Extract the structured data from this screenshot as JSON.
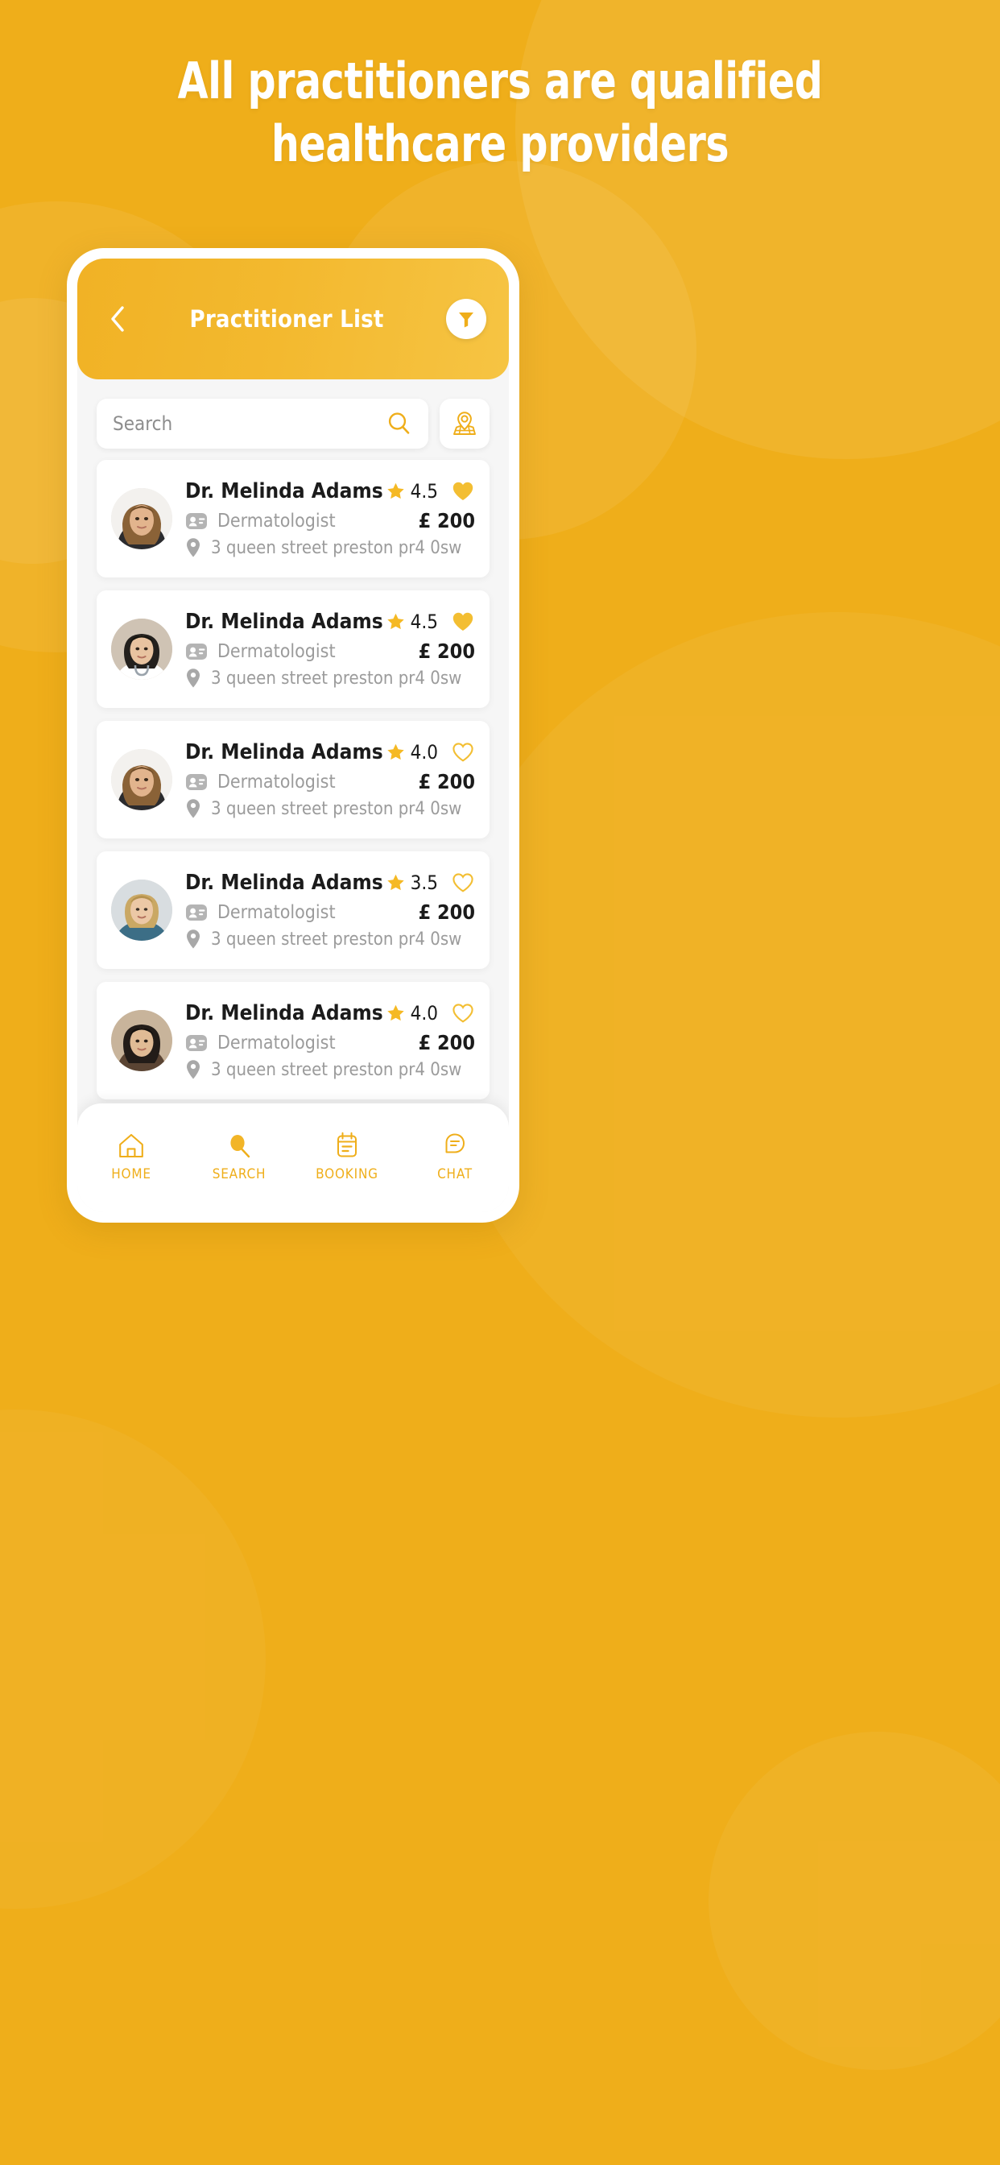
{
  "theme": {
    "brand_yellow": "#EFAE1A",
    "header_yellow": "#F3B92F",
    "star_yellow": "#F5B924",
    "heart_yellow": "#F3BE32",
    "text_dark": "#1B1B1B",
    "text_muted": "#9B9B9B",
    "screen_bg": "#F6F6F6",
    "card_bg": "#FFFFFF"
  },
  "headline": {
    "line1": "All practitioners are qualified",
    "line2": "healthcare providers"
  },
  "app_header": {
    "title": "Practitioner List",
    "back_icon": "chevron-left-icon",
    "filter_icon": "filter-funnel-icon"
  },
  "search": {
    "placeholder": "Search",
    "value": "",
    "search_icon": "search-icon",
    "map_icon": "map-pin-icon"
  },
  "practitioners": [
    {
      "name": "Dr. Melinda Adams",
      "rating": "4.5",
      "favorited": true,
      "specialty": "Dermatologist",
      "price": "£ 200",
      "address": "3 queen street preston pr4 0sw",
      "avatar": "woman-long-brown-hair-black-top",
      "badge_icon": "id-badge-icon",
      "pin_icon": "location-pin-icon",
      "star_icon": "star-icon",
      "heart_icon": "heart-filled-icon"
    },
    {
      "name": "Dr. Melinda Adams",
      "rating": "4.5",
      "favorited": true,
      "specialty": "Dermatologist",
      "price": "£ 200",
      "address": "3 queen street preston pr4 0sw",
      "avatar": "woman-doctor-white-coat-stethoscope",
      "badge_icon": "id-badge-icon",
      "pin_icon": "location-pin-icon",
      "star_icon": "star-icon",
      "heart_icon": "heart-filled-icon"
    },
    {
      "name": "Dr. Melinda Adams",
      "rating": "4.0",
      "favorited": false,
      "specialty": "Dermatologist",
      "price": "£ 200",
      "address": "3 queen street preston pr4 0sw",
      "avatar": "woman-long-brown-hair-black-top",
      "badge_icon": "id-badge-icon",
      "pin_icon": "location-pin-icon",
      "star_icon": "star-icon",
      "heart_icon": "heart-outline-icon"
    },
    {
      "name": "Dr. Melinda Adams",
      "rating": "3.5",
      "favorited": false,
      "specialty": "Dermatologist",
      "price": "£ 200",
      "address": "3 queen street preston pr4 0sw",
      "avatar": "woman-blonde-blue-scrubs",
      "badge_icon": "id-badge-icon",
      "pin_icon": "location-pin-icon",
      "star_icon": "star-icon",
      "heart_icon": "heart-outline-icon"
    },
    {
      "name": "Dr. Melinda Adams",
      "rating": "4.0",
      "favorited": false,
      "specialty": "Dermatologist",
      "price": "£ 200",
      "address": "3 queen street preston pr4 0sw",
      "avatar": "woman-dark-hair-portrait",
      "badge_icon": "id-badge-icon",
      "pin_icon": "location-pin-icon",
      "star_icon": "star-icon",
      "heart_icon": "heart-outline-icon"
    }
  ],
  "bottom_nav": [
    {
      "label": "HOME",
      "icon": "home-icon"
    },
    {
      "label": "SEARCH",
      "icon": "search-icon"
    },
    {
      "label": "BOOKING",
      "icon": "calendar-icon"
    },
    {
      "label": "CHAT",
      "icon": "chat-bubble-icon"
    }
  ]
}
